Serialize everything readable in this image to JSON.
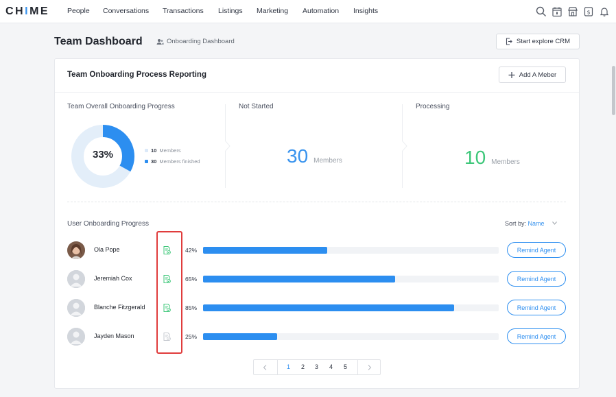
{
  "app": {
    "logo": "CHIME"
  },
  "nav": [
    "People",
    "Conversations",
    "Transactions",
    "Listings",
    "Marketing",
    "Automation",
    "Insights"
  ],
  "header": {
    "title": "Team Dashboard",
    "sublink": "Onboarding Dashboard",
    "explore_button": "Start explore CRM"
  },
  "card": {
    "title": "Team Onboarding Process Reporting",
    "add_button": "Add A Meber",
    "overall": {
      "label": "Team Overall Onboarding  Progress",
      "percent_text": "33%",
      "percent_value": 0.33,
      "legend": [
        {
          "count": "10",
          "text": "Members",
          "color": "#dbe9f9"
        },
        {
          "count": "30",
          "text": "Members finished",
          "color": "#2c8ef0"
        }
      ]
    },
    "not_started": {
      "label": "Not Started",
      "value": "30",
      "unit": "Members",
      "color": "#3a94ee"
    },
    "processing": {
      "label": "Processing",
      "value": "10",
      "unit": "Members",
      "color": "#3ec77a"
    }
  },
  "progress": {
    "title": "User Onboarding Progress",
    "sort_label": "Sort by:",
    "sort_value": "Name",
    "remind_label": "Remind Agent",
    "agents": [
      {
        "name": "Ola Pope",
        "percent": "42%",
        "value": 0.42,
        "doc_status": "complete",
        "avatar": "photo"
      },
      {
        "name": "Jeremiah Cox",
        "percent": "65%",
        "value": 0.65,
        "doc_status": "complete",
        "avatar": "placeholder"
      },
      {
        "name": "Blanche Fitzgerald",
        "percent": "85%",
        "value": 0.85,
        "doc_status": "complete",
        "avatar": "placeholder"
      },
      {
        "name": "Jayden Mason",
        "percent": "25%",
        "value": 0.25,
        "doc_status": "pending",
        "avatar": "placeholder"
      }
    ]
  },
  "pagination": {
    "pages": [
      "1",
      "2",
      "3",
      "4",
      "5"
    ],
    "current": "1"
  },
  "colors": {
    "accent": "#2c8ef0",
    "success": "#3ec77a",
    "highlight": "#e03c3c"
  }
}
